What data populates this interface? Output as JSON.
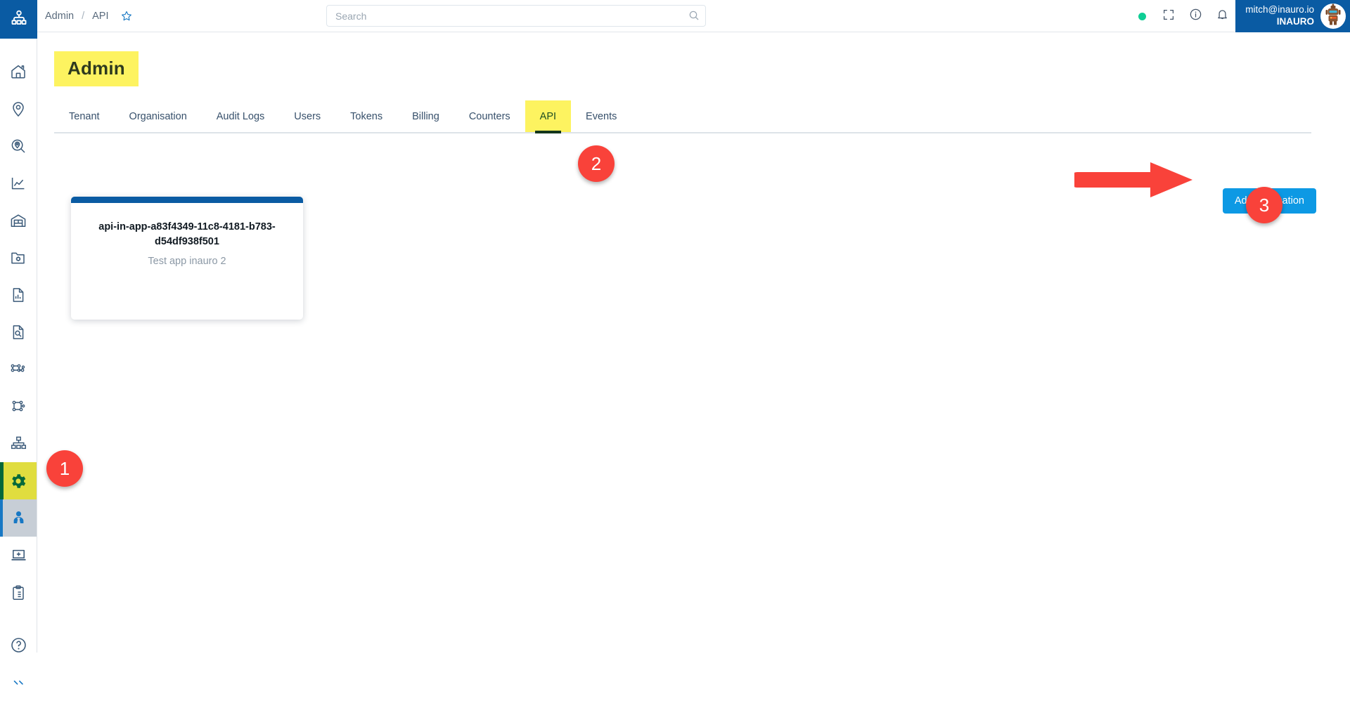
{
  "app": {
    "logo_icon": "hierarchy-logo-icon",
    "accent_blue": "#0a5ba3",
    "button_blue": "#0d99e4",
    "highlight_yellow": "#fdf360",
    "marker_red": "#f9423a",
    "status_green": "#0fce95"
  },
  "topbar": {
    "breadcrumb": {
      "root": "Admin",
      "separator": "/",
      "current": "API"
    },
    "favorite_icon": "star-icon",
    "search": {
      "placeholder": "Search",
      "value": "",
      "icon": "search-icon"
    },
    "status_indicator": {
      "name": "status-dot",
      "color": "#0fce95"
    },
    "icons": [
      {
        "name": "fullscreen-icon",
        "glyph": "fullscreen"
      },
      {
        "name": "info-icon",
        "glyph": "info"
      },
      {
        "name": "notifications-bell-icon",
        "glyph": "bell"
      }
    ],
    "user": {
      "email": "mitch@inauro.io",
      "organisation": "INAURO",
      "avatar_icon": "robot-avatar"
    }
  },
  "sidebar": {
    "items": [
      {
        "name": "sidebar-item-home",
        "icon": "home-icon",
        "state": "default"
      },
      {
        "name": "sidebar-item-locations",
        "icon": "map-pin-icon",
        "state": "default"
      },
      {
        "name": "sidebar-item-location-search",
        "icon": "pin-search-icon",
        "state": "default"
      },
      {
        "name": "sidebar-item-analytics",
        "icon": "line-chart-icon",
        "state": "default"
      },
      {
        "name": "sidebar-item-assets",
        "icon": "warehouse-icon",
        "state": "default"
      },
      {
        "name": "sidebar-item-folder-settings",
        "icon": "folder-gear-icon",
        "state": "default"
      },
      {
        "name": "sidebar-item-reports",
        "icon": "document-chart-icon",
        "state": "default"
      },
      {
        "name": "sidebar-item-document-search",
        "icon": "document-search-icon",
        "state": "default"
      },
      {
        "name": "sidebar-item-network",
        "icon": "network-nodes-icon",
        "state": "default"
      },
      {
        "name": "sidebar-item-graph",
        "icon": "graph-nodes-icon",
        "state": "default"
      },
      {
        "name": "sidebar-item-hierarchy",
        "icon": "org-hierarchy-icon",
        "state": "default"
      },
      {
        "name": "sidebar-item-settings",
        "icon": "gear-icon",
        "state": "highlighted"
      },
      {
        "name": "sidebar-item-admin-users",
        "icon": "person-tie-icon",
        "state": "selected"
      },
      {
        "name": "sidebar-item-add-device",
        "icon": "laptop-plus-icon",
        "state": "default"
      },
      {
        "name": "sidebar-item-tasks",
        "icon": "clipboard-list-icon",
        "state": "default"
      },
      {
        "name": "sidebar-item-help",
        "icon": "help-circle-icon",
        "state": "default"
      }
    ]
  },
  "page": {
    "title": "Admin",
    "tabs": [
      {
        "label": "Tenant",
        "active": false,
        "highlighted": false
      },
      {
        "label": "Organisation",
        "active": false,
        "highlighted": false
      },
      {
        "label": "Audit Logs",
        "active": false,
        "highlighted": false
      },
      {
        "label": "Users",
        "active": false,
        "highlighted": false
      },
      {
        "label": "Tokens",
        "active": false,
        "highlighted": false
      },
      {
        "label": "Billing",
        "active": false,
        "highlighted": false
      },
      {
        "label": "Counters",
        "active": false,
        "highlighted": false
      },
      {
        "label": "API",
        "active": true,
        "highlighted": true
      },
      {
        "label": "Events",
        "active": false,
        "highlighted": false
      }
    ],
    "add_application_label": "Add application",
    "applications": [
      {
        "title": "api-in-app-a83f4349-11c8-4181-b783-d54df938f501",
        "description": "Test app inauro 2"
      }
    ]
  },
  "annotations": {
    "markers": [
      {
        "label": "1",
        "target": "sidebar-item-settings"
      },
      {
        "label": "2",
        "target": "tab-api"
      },
      {
        "label": "3",
        "target": "add-application-button"
      }
    ],
    "arrow": {
      "name": "pointer-arrow",
      "direction": "right",
      "color": "#f9423a"
    }
  }
}
